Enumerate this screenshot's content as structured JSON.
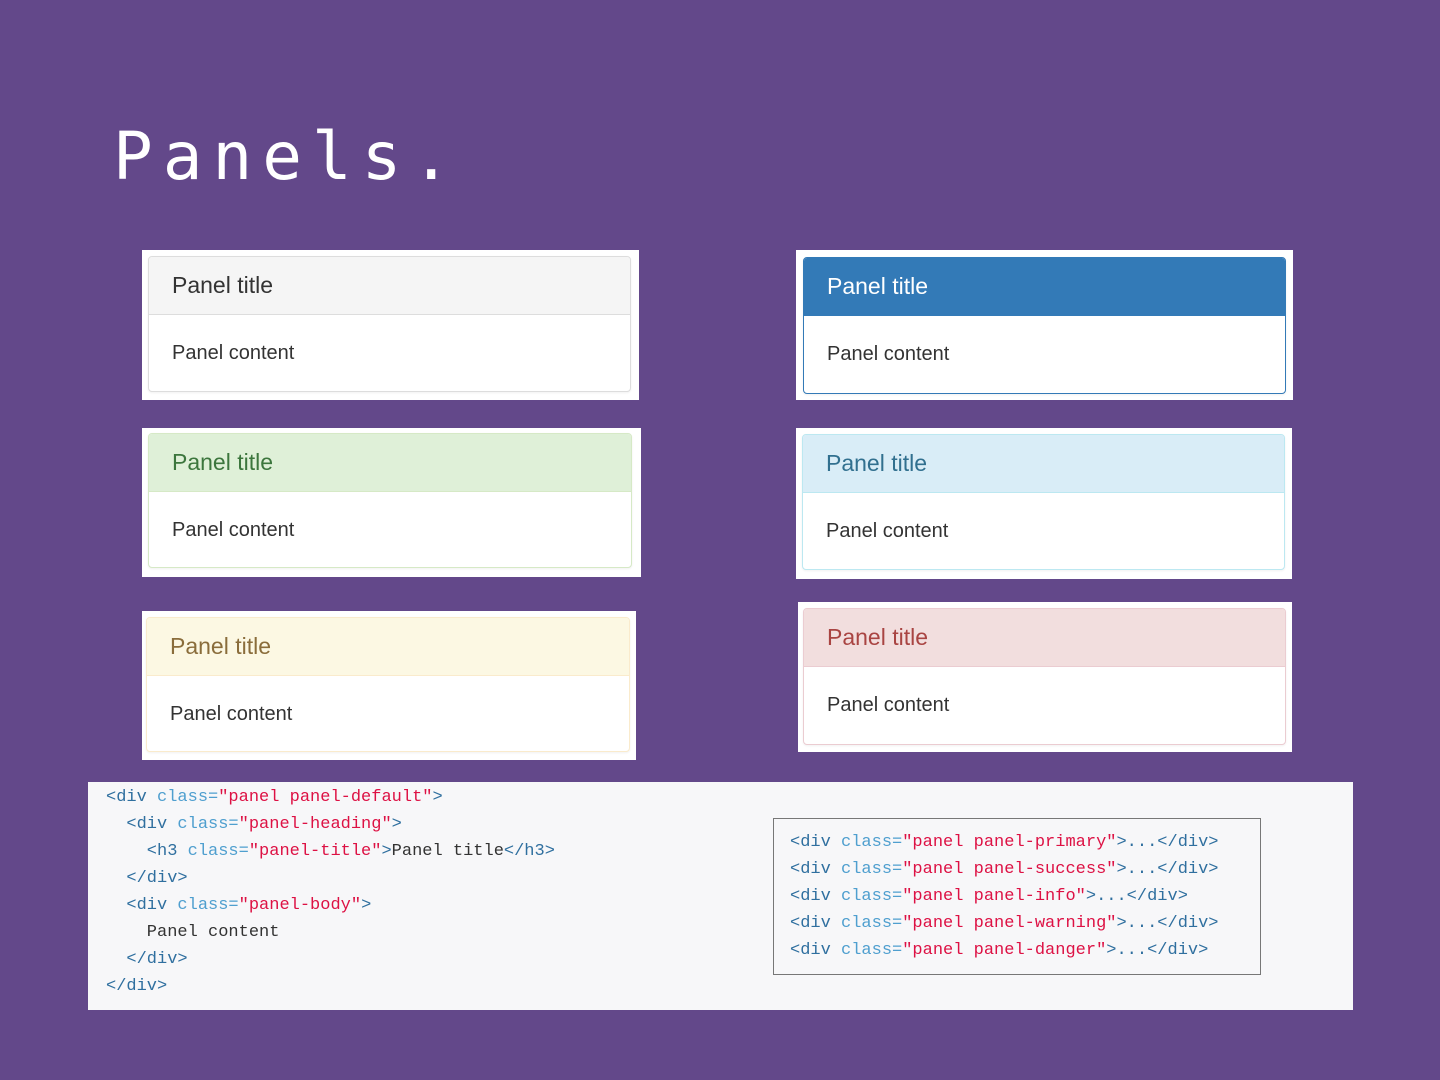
{
  "title": "Panels.",
  "panels": [
    {
      "variant": "default",
      "title": "Panel title",
      "content": "Panel content",
      "heading_bg": "#f5f5f5",
      "heading_color": "#333333",
      "border": "#dddddd"
    },
    {
      "variant": "primary",
      "title": "Panel title",
      "content": "Panel content",
      "heading_bg": "#337ab7",
      "heading_color": "#ffffff",
      "border": "#337ab7"
    },
    {
      "variant": "success",
      "title": "Panel title",
      "content": "Panel content",
      "heading_bg": "#dff0d8",
      "heading_color": "#3c763d",
      "border": "#d6e9c6"
    },
    {
      "variant": "info",
      "title": "Panel title",
      "content": "Panel content",
      "heading_bg": "#d9edf7",
      "heading_color": "#31708f",
      "border": "#bce8f1"
    },
    {
      "variant": "warning",
      "title": "Panel title",
      "content": "Panel content",
      "heading_bg": "#fcf8e3",
      "heading_color": "#8a6d3b",
      "border": "#faebcc"
    },
    {
      "variant": "danger",
      "title": "Panel title",
      "content": "Panel content",
      "heading_bg": "#f2dede",
      "heading_color": "#a94442",
      "border": "#ebccd1"
    }
  ],
  "code_main": [
    [
      [
        "tag",
        "<div "
      ],
      [
        "attr",
        "class="
      ],
      [
        "str",
        "\"panel panel-default\""
      ],
      [
        "tag",
        ">"
      ]
    ],
    [
      [
        "tag",
        "  <div "
      ],
      [
        "attr",
        "class="
      ],
      [
        "str",
        "\"panel-heading\""
      ],
      [
        "tag",
        ">"
      ]
    ],
    [
      [
        "tag",
        "    <h3 "
      ],
      [
        "attr",
        "class="
      ],
      [
        "str",
        "\"panel-title\""
      ],
      [
        "tag",
        ">"
      ],
      [
        "txt",
        "Panel title"
      ],
      [
        "tag",
        "</h3>"
      ]
    ],
    [
      [
        "tag",
        "  </div>"
      ]
    ],
    [
      [
        "tag",
        "  <div "
      ],
      [
        "attr",
        "class="
      ],
      [
        "str",
        "\"panel-body\""
      ],
      [
        "tag",
        ">"
      ]
    ],
    [
      [
        "txt",
        "    Panel content"
      ]
    ],
    [
      [
        "tag",
        "  </div>"
      ]
    ],
    [
      [
        "tag",
        "</div>"
      ]
    ]
  ],
  "code_variants": [
    [
      [
        "tag",
        "<div "
      ],
      [
        "attr",
        "class="
      ],
      [
        "str",
        "\"panel panel-primary\""
      ],
      [
        "tag",
        ">...</div>"
      ]
    ],
    [
      [
        "tag",
        "<div "
      ],
      [
        "attr",
        "class="
      ],
      [
        "str",
        "\"panel panel-success\""
      ],
      [
        "tag",
        ">...</div>"
      ]
    ],
    [
      [
        "tag",
        "<div "
      ],
      [
        "attr",
        "class="
      ],
      [
        "str",
        "\"panel panel-info\""
      ],
      [
        "tag",
        ">...</div>"
      ]
    ],
    [
      [
        "tag",
        "<div "
      ],
      [
        "attr",
        "class="
      ],
      [
        "str",
        "\"panel panel-warning\""
      ],
      [
        "tag",
        ">...</div>"
      ]
    ],
    [
      [
        "tag",
        "<div "
      ],
      [
        "attr",
        "class="
      ],
      [
        "str",
        "\"panel panel-danger\""
      ],
      [
        "tag",
        ">...</div>"
      ]
    ]
  ]
}
